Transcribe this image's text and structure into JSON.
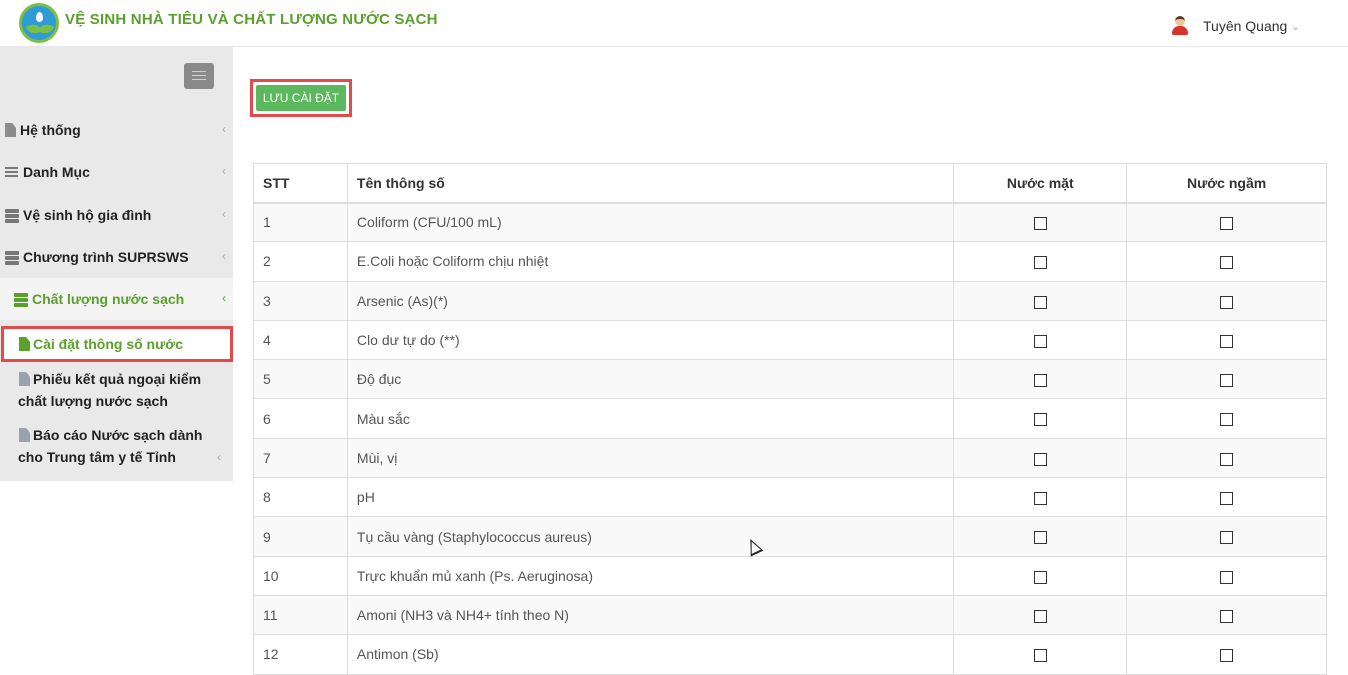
{
  "header": {
    "app_title": "VỆ SINH NHÀ TIÊU VÀ CHẤT LƯỢNG NƯỚC SẠCH",
    "user_name": "Tuyên Quang"
  },
  "sidebar": {
    "items": [
      {
        "label": "Hệ thống",
        "icon": "document-icon"
      },
      {
        "label": "Danh Mục",
        "icon": "list-icon"
      },
      {
        "label": "Vệ sinh hộ gia đình",
        "icon": "server-icon"
      },
      {
        "label": "Chương trình SUPRSWS",
        "icon": "server-icon"
      },
      {
        "label": "Chất lượng nước sạch",
        "icon": "server-icon"
      }
    ],
    "sub_items": [
      {
        "label": "Cài đặt thông số nước"
      },
      {
        "label_line1": "Phiếu kết quả ngoại kiểm",
        "label_line2": "chất lượng nước sạch"
      },
      {
        "label_line1": "Báo cáo Nước sạch dành",
        "label_line2": "cho Trung tâm y tế Tỉnh"
      }
    ]
  },
  "toolbar": {
    "save_label": "LƯU CÀI ĐẶT"
  },
  "table": {
    "headers": [
      "STT",
      "Tên thông số",
      "Nước mặt",
      "Nước ngầm"
    ],
    "rows": [
      {
        "stt": "1",
        "name": "Coliform (CFU/100 mL)"
      },
      {
        "stt": "2",
        "name": "E.Coli hoặc Coliform chịu nhiệt"
      },
      {
        "stt": "3",
        "name": "Arsenic (As)(*)"
      },
      {
        "stt": "4",
        "name": "Clo dư tự do (**)"
      },
      {
        "stt": "5",
        "name": "Độ đục"
      },
      {
        "stt": "6",
        "name": "Màu sắc"
      },
      {
        "stt": "7",
        "name": "Mùi, vị"
      },
      {
        "stt": "8",
        "name": "pH"
      },
      {
        "stt": "9",
        "name": "Tụ cầu vàng (Staphylococcus aureus)"
      },
      {
        "stt": "10",
        "name": "Trực khuẩn mủ xanh (Ps. Aeruginosa)"
      },
      {
        "stt": "11",
        "name": "Amoni (NH3 và NH4+ tính theo N)"
      },
      {
        "stt": "12",
        "name": "Antimon (Sb)"
      }
    ]
  },
  "colors": {
    "brand_green": "#5aa02c",
    "button_green": "#5cb85c",
    "highlight_red": "#e34a4a"
  }
}
